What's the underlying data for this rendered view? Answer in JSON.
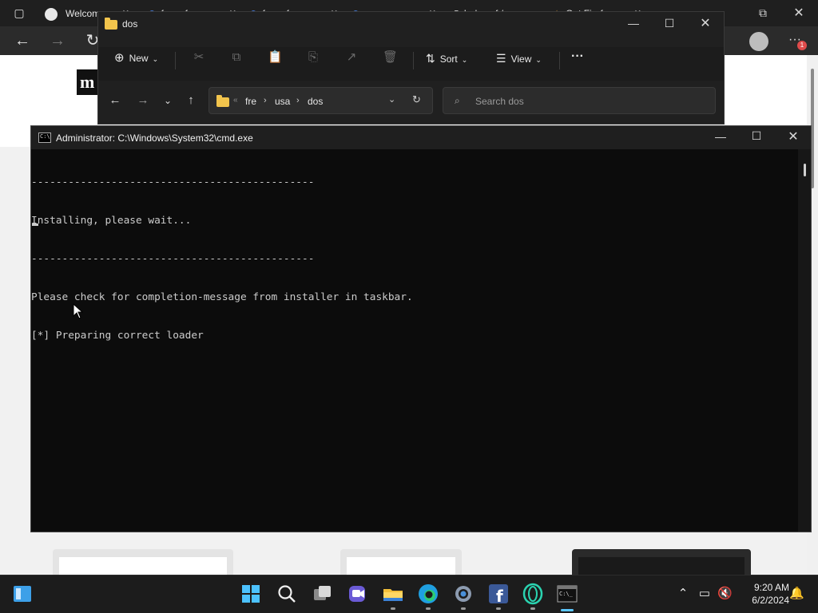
{
  "browser": {
    "tabs": [
      {
        "label": "Welcome"
      },
      {
        "label": "fame fo..."
      },
      {
        "label": "fame fo..."
      },
      {
        "label": "zoom ..."
      },
      {
        "label": "Index of /..."
      },
      {
        "label": "Get Firefox"
      }
    ],
    "notification_count": "1",
    "page_logo_letter": "m"
  },
  "explorer": {
    "title": "dos",
    "commands": {
      "new_label": "New",
      "sort_label": "Sort",
      "view_label": "View",
      "more_label": "···"
    },
    "breadcrumb": [
      "fre",
      "usa",
      "dos"
    ],
    "search_placeholder": "Search dos"
  },
  "cmd": {
    "title": "Administrator: C:\\Windows\\System32\\cmd.exe",
    "lines": [
      "----------------------------------------------",
      "Installing, please wait...",
      "----------------------------------------------",
      "Please check for completion-message from installer in taskbar.",
      "[*] Preparing correct loader"
    ]
  },
  "taskbar": {
    "apps": [
      "start",
      "search",
      "task-view",
      "teams",
      "file-explorer",
      "edge",
      "settings",
      "facebook",
      "opera",
      "terminal"
    ],
    "time": "9:20 AM",
    "date": "6/2/2024"
  },
  "colors": {
    "explorer_bg": "#202020",
    "cmd_bg": "#0c0c0c",
    "console_text": "#cccccc",
    "taskbar_bg": "#1c1c1c",
    "accent": "#5cc8ff"
  }
}
